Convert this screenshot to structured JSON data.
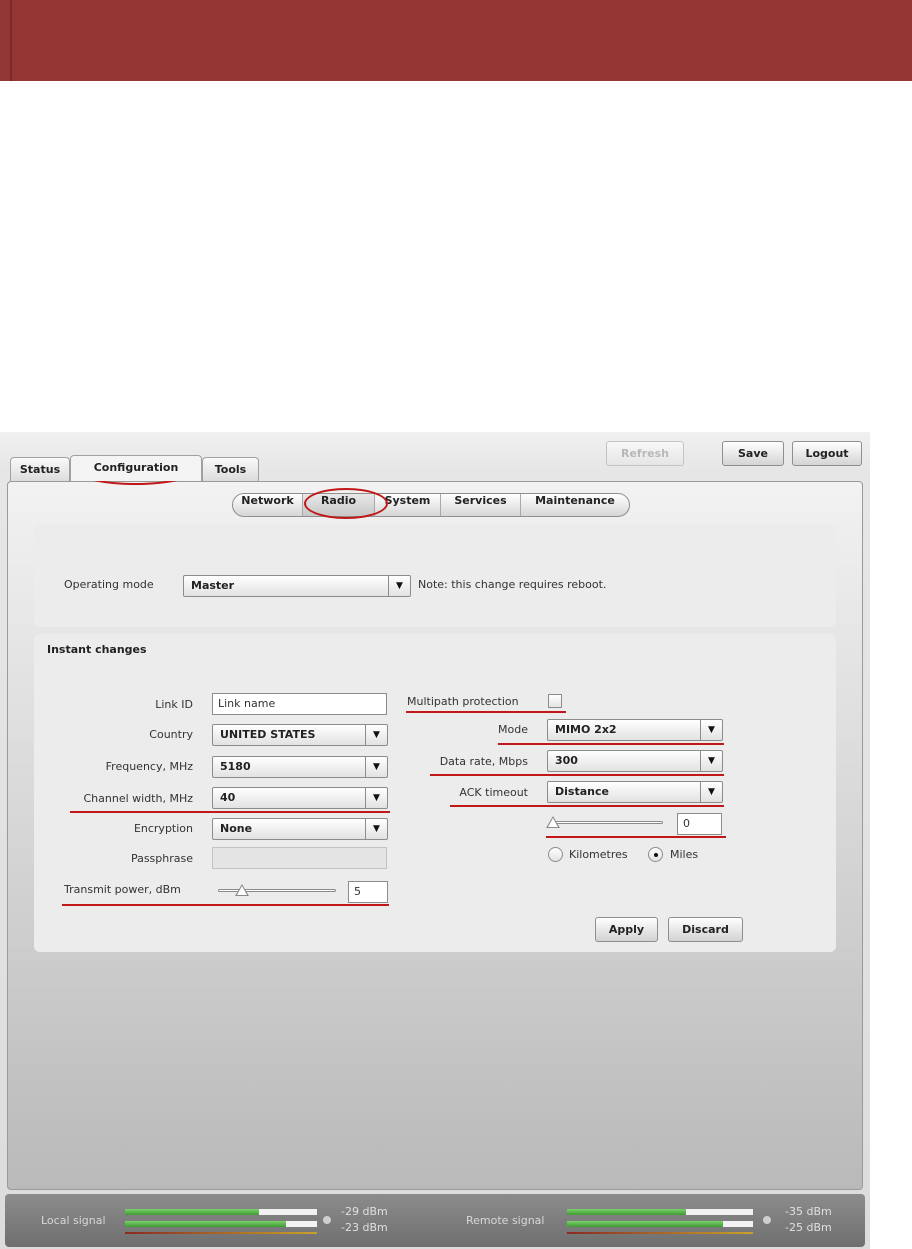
{
  "header": {
    "tabs": [
      {
        "label": "Status"
      },
      {
        "label": "Configuration"
      },
      {
        "label": "Tools"
      }
    ],
    "buttons": {
      "refresh": "Refresh",
      "save": "Save",
      "logout": "Logout"
    }
  },
  "subnav": {
    "items": [
      {
        "label": "Network"
      },
      {
        "label": "Radio"
      },
      {
        "label": "System"
      },
      {
        "label": "Services"
      },
      {
        "label": "Maintenance"
      }
    ],
    "active": "Radio"
  },
  "operating": {
    "label": "Operating mode",
    "value": "Master",
    "note": "Note: this change requires reboot."
  },
  "instant": {
    "title": "Instant changes",
    "link_id": {
      "label": "Link ID",
      "value": "Link name"
    },
    "country": {
      "label": "Country",
      "value": "UNITED STATES"
    },
    "frequency": {
      "label": "Frequency, MHz",
      "value": "5180"
    },
    "channel_width": {
      "label": "Channel width, MHz",
      "value": "40"
    },
    "encryption": {
      "label": "Encryption",
      "value": "None"
    },
    "passphrase": {
      "label": "Passphrase",
      "value": ""
    },
    "transmit_power": {
      "label": "Transmit power, dBm",
      "value": "5",
      "slider_fraction": 0.2
    },
    "multipath": {
      "label": "Multipath protection",
      "checked": false
    },
    "mode": {
      "label": "Mode",
      "value": "MIMO 2x2"
    },
    "data_rate": {
      "label": "Data rate, Mbps",
      "value": "300"
    },
    "ack_timeout": {
      "label": "ACK timeout",
      "value": "Distance",
      "distance_value": "0",
      "slider_fraction": 0.0
    },
    "units": {
      "kilometres": "Kilometres",
      "miles": "Miles",
      "selected": "Miles"
    },
    "apply": "Apply",
    "discard": "Discard"
  },
  "footer": {
    "local": {
      "label": "Local signal",
      "values": [
        "-29 dBm",
        "-23 dBm"
      ],
      "levels": [
        0.7,
        0.84
      ]
    },
    "remote": {
      "label": "Remote signal",
      "values": [
        "-35 dBm",
        "-25 dBm"
      ],
      "levels": [
        0.64,
        0.84
      ]
    }
  },
  "colors": {
    "banner": "#943634",
    "annotation": "#c01818",
    "signal_green": "#4fae3f"
  }
}
